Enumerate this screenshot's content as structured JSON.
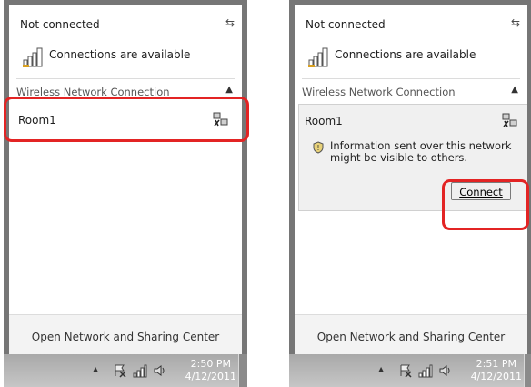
{
  "panels": [
    {
      "status": "Not connected",
      "refresh_icon": "refresh-arrows-icon",
      "availability": "Connections are available",
      "section_title": "Wireless Network Connection",
      "network_name": "Room1",
      "footer_link": "Open Network and Sharing Center",
      "clock_time": "2:50 PM",
      "clock_date": "4/12/2011"
    },
    {
      "status": "Not connected",
      "refresh_icon": "refresh-arrows-icon",
      "availability": "Connections are available",
      "section_title": "Wireless Network Connection",
      "network_name": "Room1",
      "info_text": "Information sent over this network might be visible to others.",
      "connect_label": "Connect",
      "footer_link": "Open Network and Sharing Center",
      "clock_time": "2:51 PM",
      "clock_date": "4/12/2011"
    }
  ],
  "colors": {
    "highlight": "#e32424",
    "frame": "#767676",
    "taskbar": "#b5b5b5"
  }
}
